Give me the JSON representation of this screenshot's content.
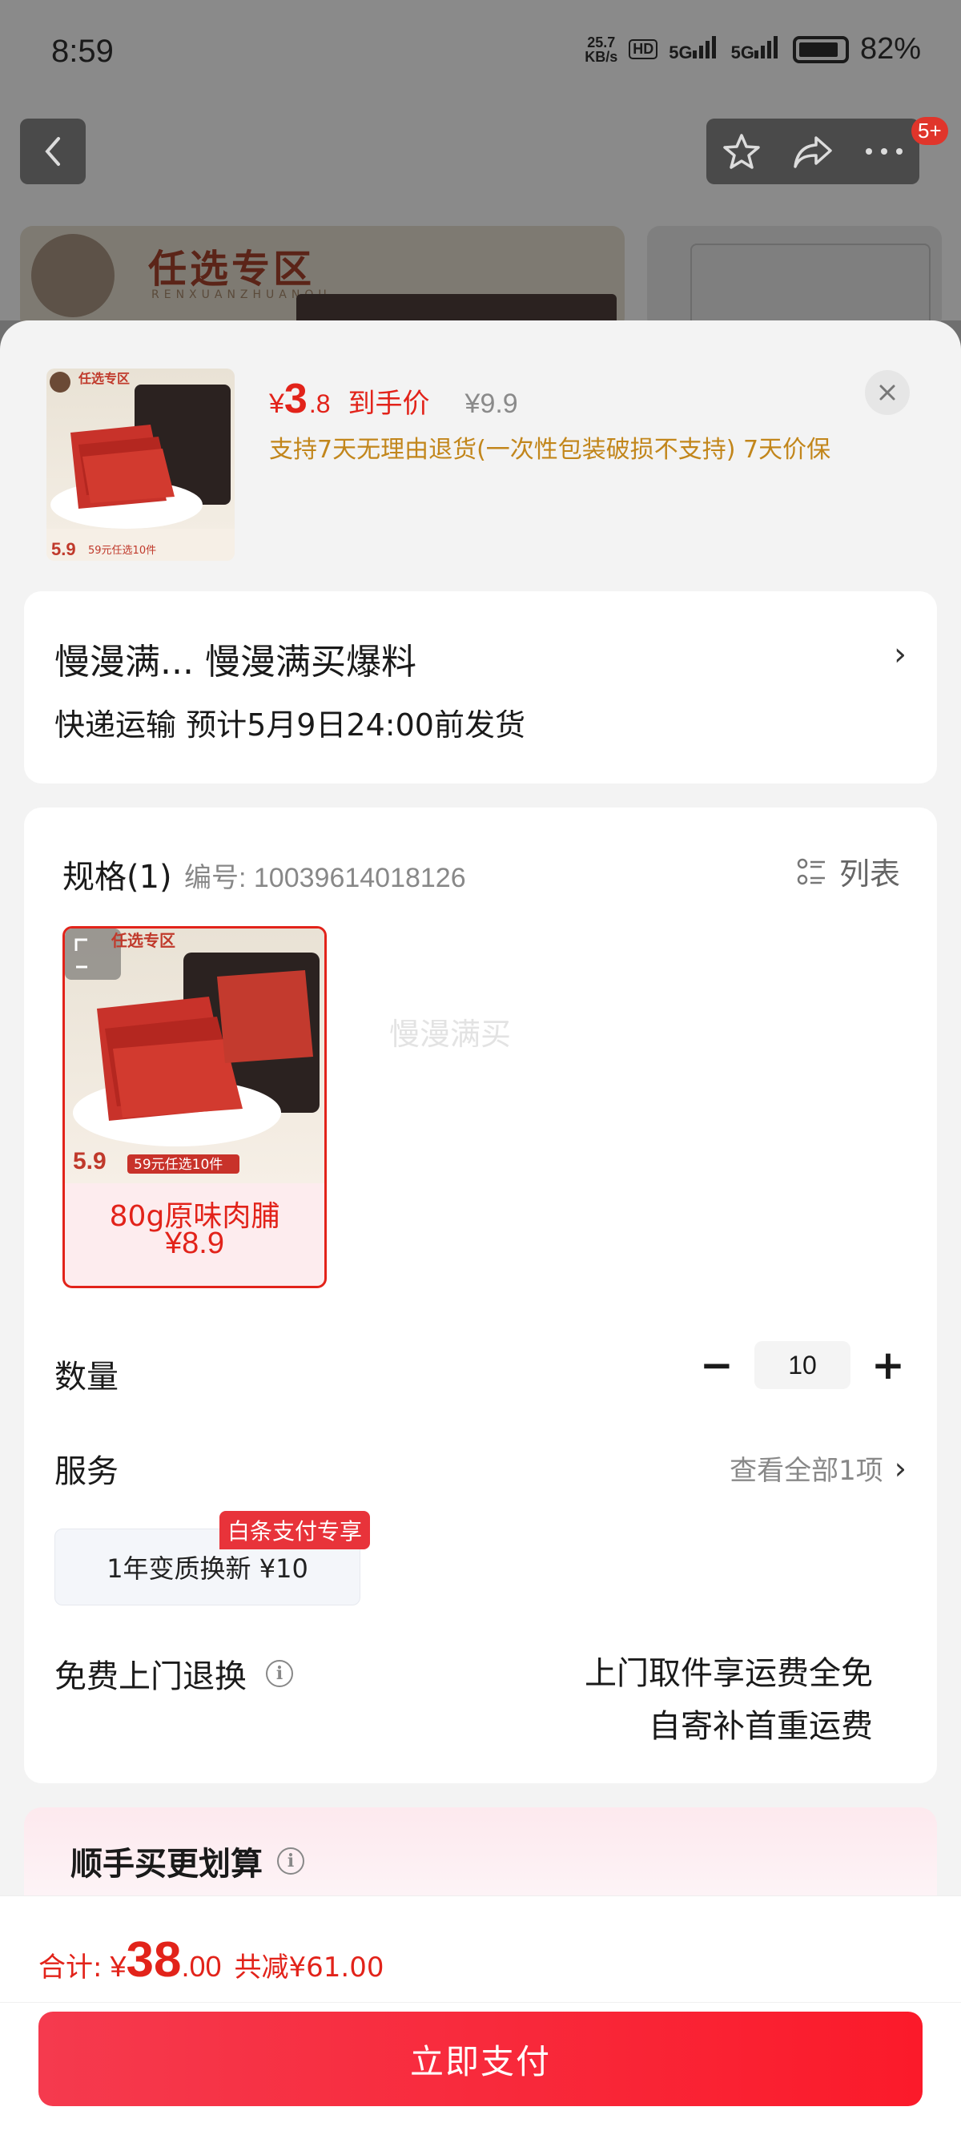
{
  "status": {
    "time": "8:59",
    "net_speed_value": "25.7",
    "net_speed_unit": "KB/s",
    "hd_label": "HD",
    "signal1": "5G",
    "signal2": "5G",
    "battery": "82%"
  },
  "top": {
    "badge": "5+"
  },
  "banner": {
    "title": "任选专区",
    "sub": "RENXUANZHUANQU"
  },
  "product": {
    "thumb_tag": "任选专区",
    "thumb_price": "5.9",
    "thumb_promo": "59元任选10件",
    "price_yen": "¥",
    "price_int": "3",
    "price_dec": ".8",
    "price_label": "到手价",
    "orig_price": "¥9.9",
    "policy": "支持7天无理由退货(一次性包装破损不支持) 7天价保"
  },
  "address": {
    "title": "慢漫满...  慢漫满买爆料",
    "shipping": "快递运输 预计5月9日24:00前发货"
  },
  "spec": {
    "title": "规格(1)",
    "code": "编号: 10039614018126",
    "list_label": "列表",
    "sku": {
      "img_tag": "任选专区",
      "img_price": "5.9",
      "img_promo": "59元任选10件",
      "name": "80g原味肉脯",
      "price": "¥8.9"
    },
    "watermark": "慢漫满买"
  },
  "quantity": {
    "label": "数量",
    "value": "10",
    "minus": "−",
    "plus": "+"
  },
  "service": {
    "label": "服务",
    "view_all": "查看全部1项",
    "chip": "1年变质换新  ¥10",
    "tag": "白条支付专享"
  },
  "returns": {
    "label": "免费上门退换",
    "line1": "上门取件享运费全免",
    "line2": "自寄补首重运费"
  },
  "promo": {
    "title": "顺手买更划算"
  },
  "checkout": {
    "total_label": "合计:",
    "yen": "¥",
    "total_int": "38",
    "total_dec": ".00",
    "discount": "共减¥61.00",
    "pay_label": "立即支付"
  },
  "colors": {
    "accent": "#e2231a",
    "policy": "#c2861b",
    "pay_start": "#f53a4e",
    "pay_end": "#fb1a2a"
  }
}
